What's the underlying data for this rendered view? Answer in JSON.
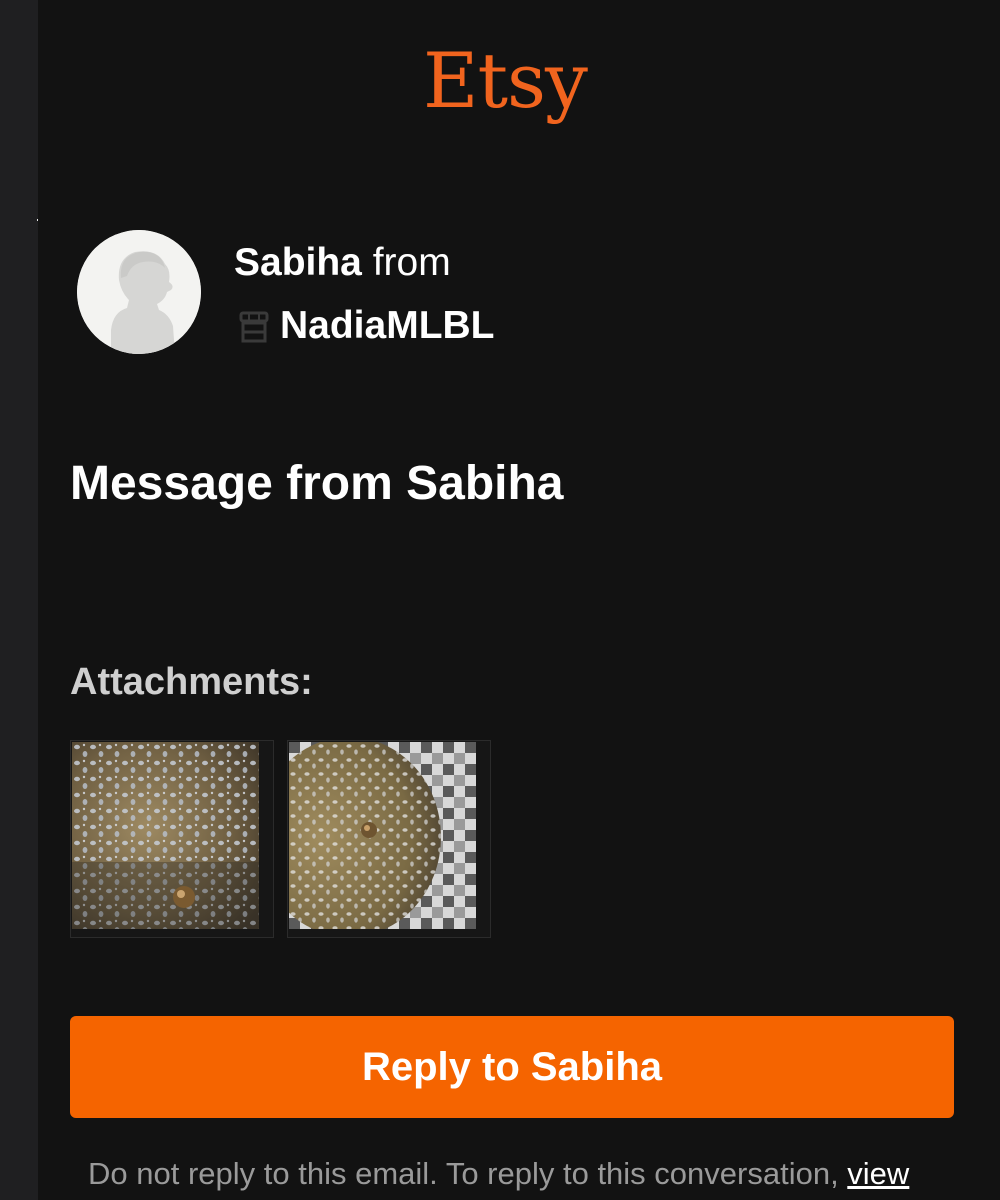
{
  "brand": {
    "logo_text": "Etsy",
    "accent_color": "#f1641e",
    "button_color": "#f56400"
  },
  "sender": {
    "name": "Sabiha",
    "from_word": "from",
    "shop_name": "NadiaMLBL",
    "avatar_icon": "default-user-avatar-icon",
    "shop_icon": "shop-storefront-icon"
  },
  "message": {
    "heading": "Message from Sabiha"
  },
  "attachments": {
    "label": "Attachments:",
    "items": [
      {
        "name": "attachment-photo-1"
      },
      {
        "name": "attachment-photo-2"
      }
    ]
  },
  "actions": {
    "reply_label": "Reply to Sabiha"
  },
  "footer": {
    "note_text": "Do not reply to this email. To reply to this conversation, ",
    "link_text": "view"
  }
}
